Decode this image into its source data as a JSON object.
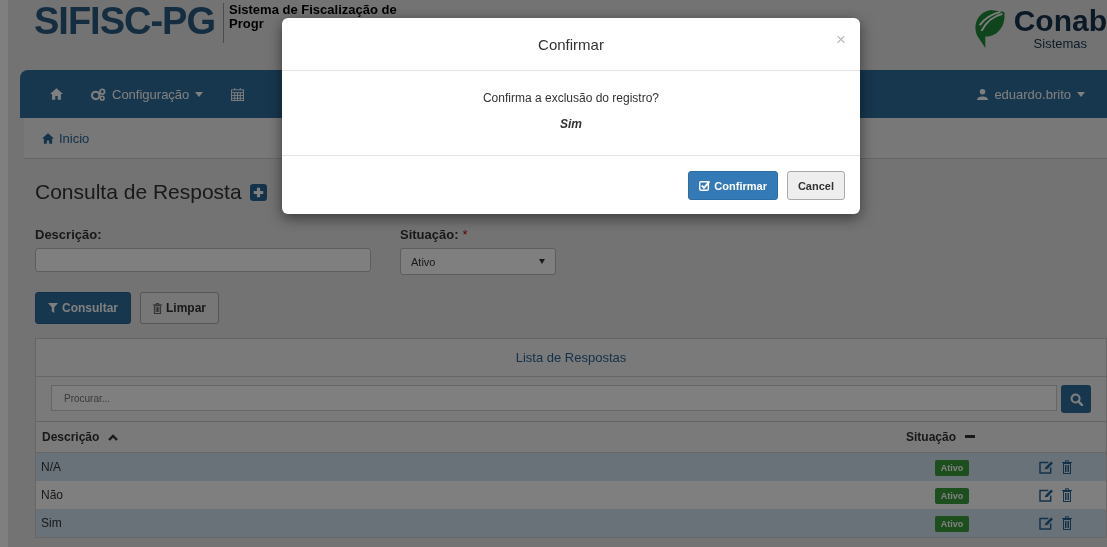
{
  "header": {
    "logo": "SIFISC-PG",
    "subtitle_lines": [
      "Sistema de Fiscalização de",
      "Progr"
    ],
    "brand": "Conab",
    "brand_sub": "Sistemas"
  },
  "nav": {
    "items": [
      {
        "kind": "home"
      },
      {
        "kind": "menu",
        "label": "Configuração"
      },
      {
        "kind": "calendar"
      }
    ],
    "user": "eduardo.brito"
  },
  "breadcrumb": "Inicio",
  "page_title": "Consulta de Resposta",
  "form": {
    "descricao": {
      "label": "Descrição:"
    },
    "situacao": {
      "label": "Situação:",
      "required_mark": "*",
      "value": "Ativo"
    }
  },
  "buttons": [
    "Consultar",
    "Limpar"
  ],
  "panel": {
    "title": "Lista de Respostas",
    "search": {
      "placeholder": "Procurar..."
    },
    "columns": [
      "Descrição",
      "Situação"
    ],
    "rows": [
      {
        "descricao": "N/A",
        "situacao": "Ativo"
      },
      {
        "descricao": "Não",
        "situacao": "Ativo"
      },
      {
        "descricao": "Sim",
        "situacao": "Ativo"
      }
    ]
  },
  "modal": {
    "title": "Confirmar",
    "close": "×",
    "message": "Confirma a exclusão do registro?",
    "item": "Sim",
    "buttons": [
      {
        "kind": "primary",
        "label": "Confirmar"
      },
      {
        "kind": "default",
        "label": "Cancel"
      }
    ]
  }
}
